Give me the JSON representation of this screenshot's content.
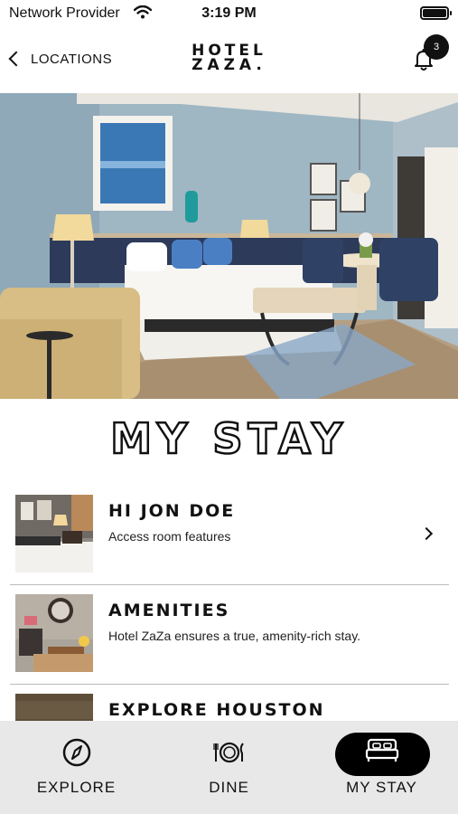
{
  "status_bar": {
    "carrier": "Network Provider",
    "time": "3:19 PM"
  },
  "nav": {
    "back_label": "LOCATIONS",
    "logo_line1": "HOTEL",
    "logo_line2": "ZAZA.",
    "notification_count": "3"
  },
  "page": {
    "title": "MY STAY"
  },
  "items": [
    {
      "title": "HI JON DOE",
      "subtitle": "Access room features",
      "has_chevron": true
    },
    {
      "title": "AMENITIES",
      "subtitle": "Hotel ZaZa ensures a true, amenity-rich stay.",
      "has_chevron": false
    },
    {
      "title": "EXPLORE HOUSTON",
      "subtitle": "",
      "has_chevron": false
    }
  ],
  "tabs": [
    {
      "label": "EXPLORE",
      "icon": "compass-icon",
      "active": false
    },
    {
      "label": "DINE",
      "icon": "dining-icon",
      "active": false
    },
    {
      "label": "MY STAY",
      "icon": "bed-icon",
      "active": true
    }
  ],
  "colors": {
    "accent": "#000000",
    "tab_bar_bg": "#e8e8e8",
    "divider": "#bbbbbb"
  }
}
